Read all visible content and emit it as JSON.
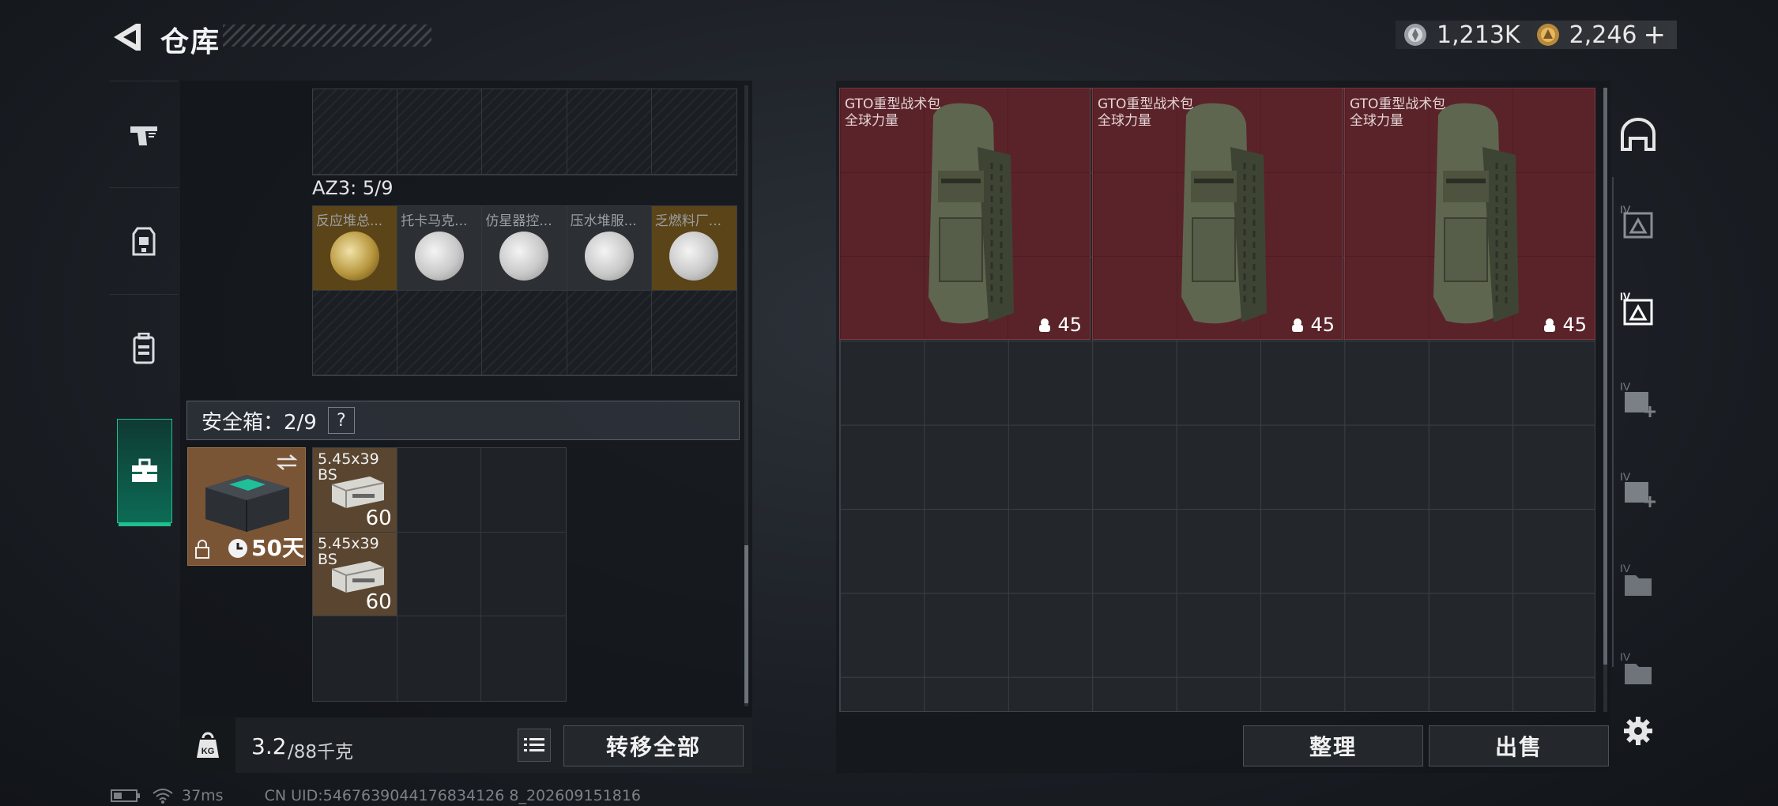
{
  "header": {
    "title": "仓库",
    "currency": [
      {
        "icon": "silver-coin-icon",
        "value": "1,213K"
      },
      {
        "icon": "gold-coin-icon",
        "value": "2,246"
      }
    ],
    "add_label": "+"
  },
  "left_tabs": [
    {
      "icon": "pistol-icon"
    },
    {
      "icon": "chest-rig-icon"
    },
    {
      "icon": "backpack-icon"
    },
    {
      "icon": "toolbox-icon",
      "active": true
    }
  ],
  "container_az3": {
    "label": "AZ3: 5/9",
    "items": [
      {
        "name": "反应堆总...",
        "tint": "gold"
      },
      {
        "name": "托卡马克...",
        "tint": "white"
      },
      {
        "name": "仿星器控...",
        "tint": "white"
      },
      {
        "name": "压水堆服...",
        "tint": "white"
      },
      {
        "name": "乏燃料厂...",
        "tint": "gold"
      }
    ]
  },
  "safebox": {
    "label": "安全箱：2/9",
    "help": "?",
    "duration": "50天",
    "items": [
      {
        "name_line1": "5.45x39",
        "name_line2": "BS",
        "count": "60"
      },
      {
        "name_line1": "5.45x39",
        "name_line2": "BS",
        "count": "60"
      }
    ]
  },
  "weight": {
    "unit_icon": "KG",
    "current": "3.2",
    "max_text": "/88千克"
  },
  "buttons": {
    "transfer_all": "转移全部",
    "sort": "整理",
    "sell": "出售"
  },
  "stash_items": [
    {
      "name": "GTO重型战术包",
      "sub": "全球力量",
      "count": "45"
    },
    {
      "name": "GTO重型战术包",
      "sub": "全球力量",
      "count": "45"
    },
    {
      "name": "GTO重型战术包",
      "sub": "全球力量",
      "count": "45"
    }
  ],
  "right_sidebar": [
    {
      "icon": "helmet-icon"
    },
    {
      "icon": "stash-page-iv-icon"
    },
    {
      "icon": "stash-page-iv-active-icon"
    },
    {
      "icon": "stash-add-iv-icon"
    },
    {
      "icon": "stash-add-iv-icon"
    },
    {
      "icon": "stash-folder-iv-icon"
    },
    {
      "icon": "stash-folder-iv-icon"
    },
    {
      "icon": "settings-icon"
    }
  ],
  "status": {
    "ping": "37ms",
    "uid": "CN UID:5467639044176834126 8_202609151816"
  },
  "colors": {
    "accent_green": "#1fbf8f",
    "bag_bg": "#5a2329",
    "gold_tint": "#7a5a17"
  }
}
